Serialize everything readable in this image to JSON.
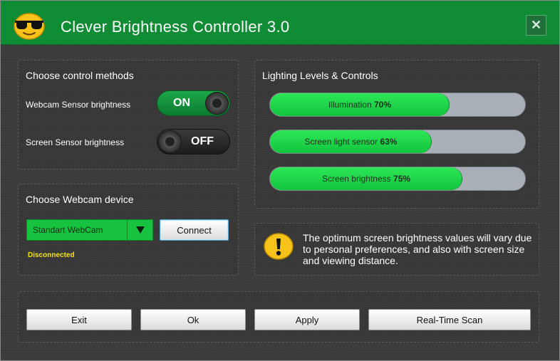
{
  "window": {
    "title": "Clever Brightness Controller 3.0",
    "close_label": "✕",
    "accent_color": "#0f8c34"
  },
  "control_methods": {
    "title": "Choose control methods",
    "rows": [
      {
        "label": "Webcam Sensor brightness",
        "state": "ON"
      },
      {
        "label": "Screen Sensor brightness",
        "state": "OFF"
      }
    ]
  },
  "webcam": {
    "title": "Choose Webcam device",
    "selected_device": "Standart WebCam",
    "connect_label": "Connect",
    "status": "Disconnected"
  },
  "levels": {
    "title": "Lighting Levels & Controls",
    "bars": [
      {
        "label": "Illumination",
        "value": "70%",
        "percent": 70
      },
      {
        "label": "Screen light sensor",
        "value": "63%",
        "percent": 63
      },
      {
        "label": "Screen brightness",
        "value": "75%",
        "percent": 75
      }
    ]
  },
  "info": {
    "text": "The optimum screen brightness values will vary due to personal preferences, and also with screen size and viewing distance."
  },
  "buttons": {
    "exit": "Exit",
    "ok": "Ok",
    "apply": "Apply",
    "scan": "Real-Time Scan"
  }
}
